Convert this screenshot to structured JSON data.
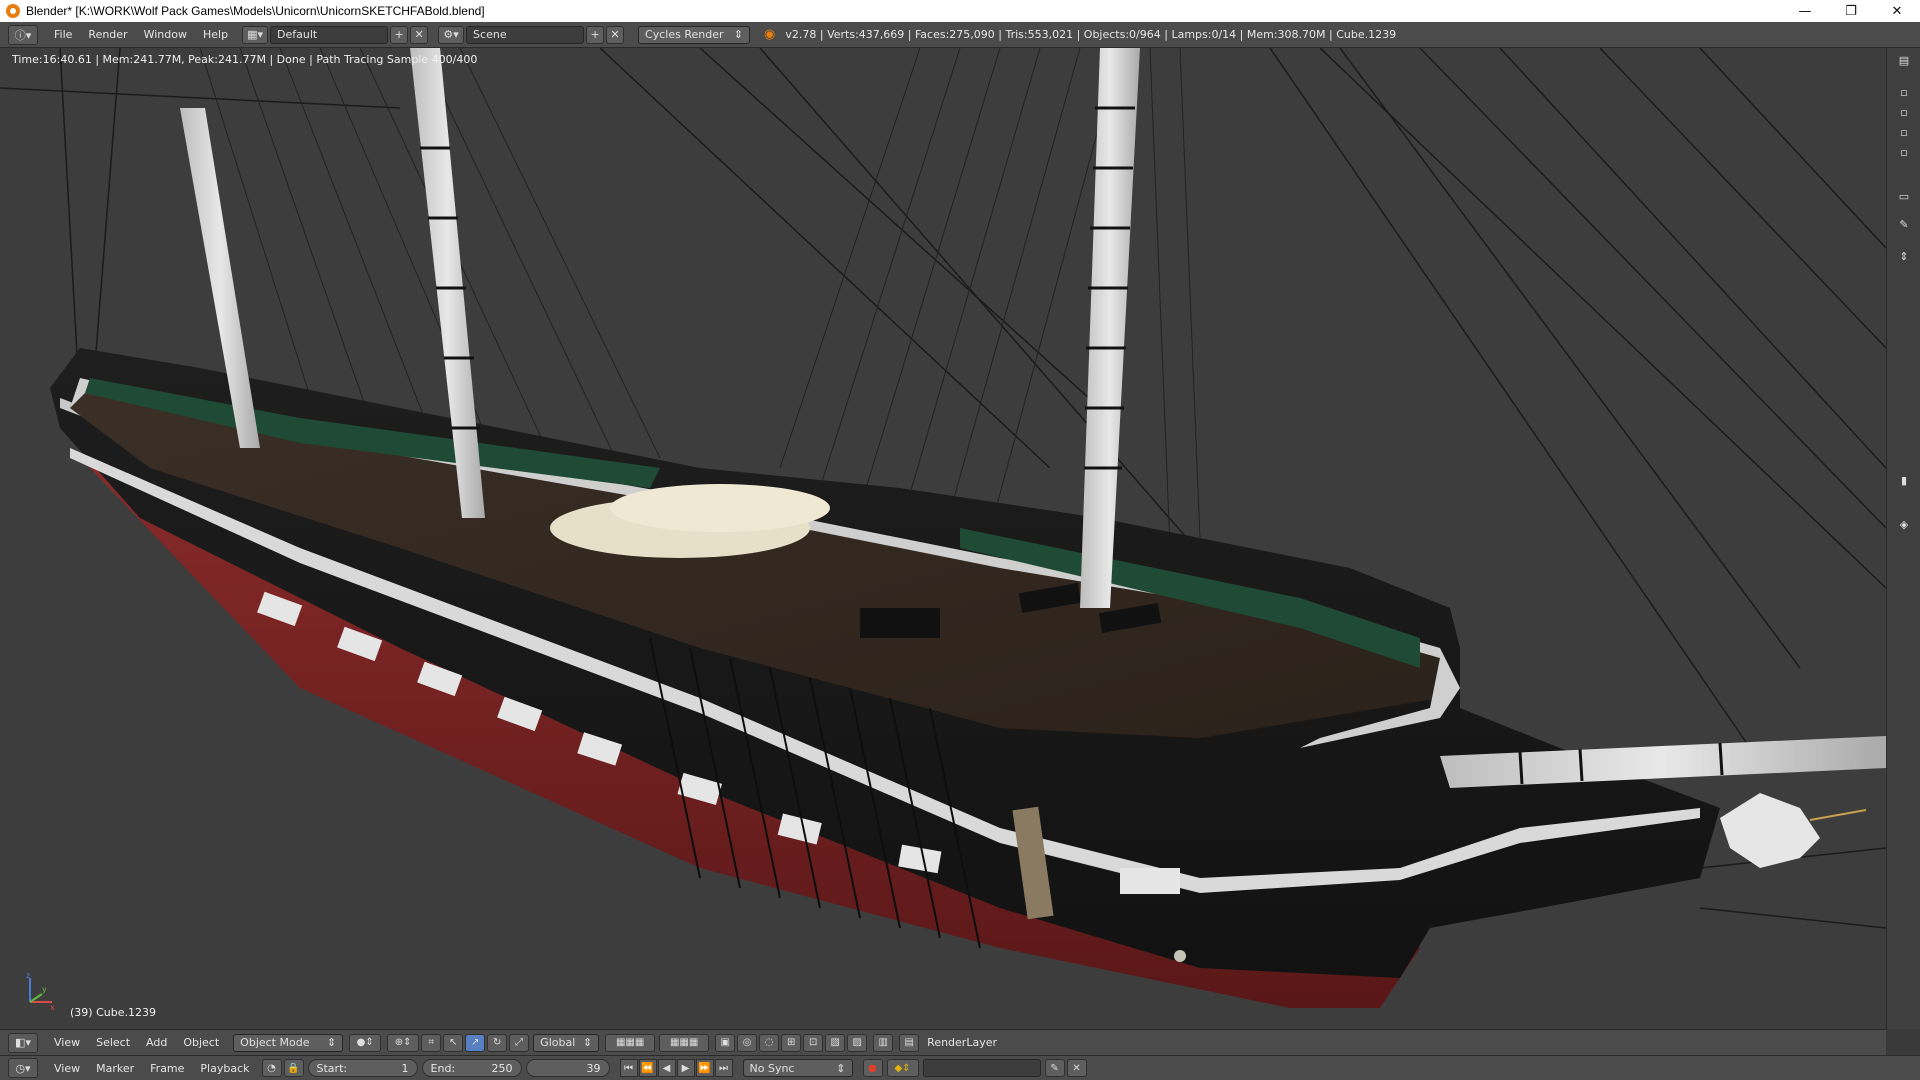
{
  "window": {
    "title": "Blender* [K:\\WORK\\Wolf Pack Games\\Models\\Unicorn\\UnicornSKETCHFABold.blend]",
    "minimize": "—",
    "maximize": "❐",
    "close": "✕"
  },
  "info_header": {
    "menus": [
      "File",
      "Render",
      "Window",
      "Help"
    ],
    "screen_layout": "Default",
    "scene": "Scene",
    "render_engine": "Cycles Render",
    "stats": "v2.78 | Verts:437,669 | Faces:275,090 | Tris:553,021 | Objects:0/964 | Lamps:0/14 | Mem:308.70M | Cube.1239"
  },
  "viewport": {
    "render_status": "Time:16:40.61 | Mem:241.77M, Peak:241.77M | Done | Path Tracing Sample 400/400",
    "object_label": "(39) Cube.1239",
    "axis_labels": {
      "x": "x",
      "y": "y",
      "z": "z"
    }
  },
  "view_header": {
    "menus": [
      "View",
      "Select",
      "Add",
      "Object"
    ],
    "mode": "Object Mode",
    "orientation": "Global",
    "render_layer": "RenderLayer"
  },
  "timeline": {
    "menus": [
      "View",
      "Marker",
      "Frame",
      "Playback"
    ],
    "start_label": "Start:",
    "start_value": "1",
    "end_label": "End:",
    "end_value": "250",
    "current_frame": "39",
    "sync": "No Sync"
  },
  "colors": {
    "accent": "#5680c2",
    "header_bg": "#4b4b4b",
    "viewport_bg": "#3d3d3d",
    "record": "#e0402a"
  }
}
